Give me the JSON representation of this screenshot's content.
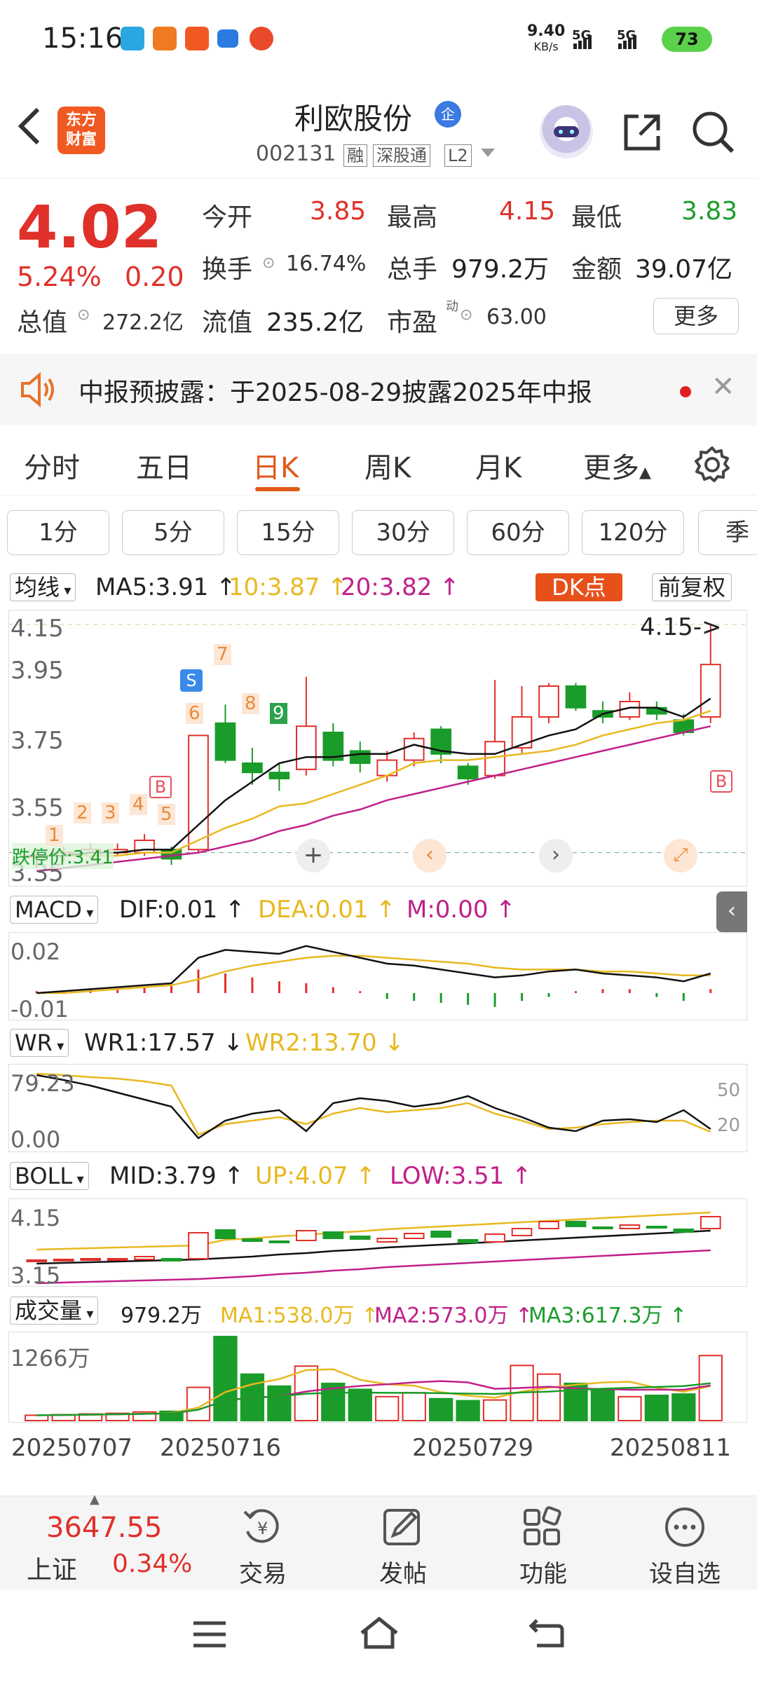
{
  "status_bar": {
    "time": "15:16",
    "net_speed": "9.40",
    "net_unit": "KB/s",
    "sim1": "5G",
    "sim2": "5G",
    "battery": "73"
  },
  "header": {
    "app_logo_line1": "东方",
    "app_logo_line2": "财富",
    "stock_name": "利欧股份",
    "badge": "企",
    "stock_code": "002131",
    "tags": [
      "融",
      "深股通",
      "L2"
    ]
  },
  "quote": {
    "price": "4.02",
    "change_pct": "5.24%",
    "change_abs": "0.20",
    "open_label": "今开",
    "open": "3.85",
    "high_label": "最高",
    "high": "4.15",
    "low_label": "最低",
    "low": "3.83",
    "turnover_label": "换手",
    "turnover": "16.74%",
    "volume_label": "总手",
    "volume": "979.2万",
    "amount_label": "金额",
    "amount": "39.07亿",
    "mktcap_label": "总值",
    "mktcap": "272.2亿",
    "float_label": "流值",
    "float": "235.2亿",
    "pe_label": "市盈",
    "pe_sup": "动",
    "pe": "63.00",
    "more": "更多"
  },
  "notice": {
    "text": "中报预披露：于2025-08-29披露2025年中报"
  },
  "period_tabs": [
    "分时",
    "五日",
    "日K",
    "周K",
    "月K",
    "更多"
  ],
  "minute_buttons": [
    "1分",
    "5分",
    "15分",
    "30分",
    "60分",
    "120分",
    "季"
  ],
  "ma_row": {
    "selector": "均线",
    "ma5": "MA5:3.91",
    "ma10": "10:3.87",
    "ma20": "20:3.82",
    "dk": "DK点",
    "adjust": "前复权"
  },
  "kline": {
    "y_labels": [
      "4.15",
      "3.95",
      "3.75",
      "3.55",
      "3.35"
    ],
    "high_marker": "4.15->",
    "limit_down_label": "跌停价:3.41",
    "b_label": "B",
    "s_label": "S",
    "seq_labels": [
      "1",
      "2",
      "3",
      "4",
      "5",
      "6",
      "7",
      "8",
      "9"
    ],
    "ma5_color": "#111111",
    "ma10_color": "#e8b820",
    "ma20_color": "#c0208a",
    "up_color": "#e0302a",
    "down_color": "#1a9c2a"
  },
  "macd_row": {
    "selector": "MACD",
    "dif": "DIF:0.01",
    "dea": "DEA:0.01",
    "m": "M:0.00",
    "y_labels": [
      "0.02",
      "-0.01"
    ]
  },
  "wr_row": {
    "selector": "WR",
    "wr1": "WR1:17.57",
    "wr2": "WR2:13.70",
    "y_labels": [
      "79.23",
      "0.00"
    ],
    "right_labels": [
      "50",
      "20"
    ]
  },
  "boll_row": {
    "selector": "BOLL",
    "mid": "MID:3.79",
    "up": "UP:4.07",
    "low": "LOW:3.51",
    "y_labels": [
      "4.15",
      "3.15"
    ]
  },
  "vol_row": {
    "selector": "成交量",
    "vol": "979.2万",
    "ma1": "MA1:538.0万",
    "ma2": "MA2:573.0万",
    "ma3": "MA3:617.3万",
    "y_label": "1266万"
  },
  "dates": [
    "20250707",
    "20250716",
    "20250729",
    "20250811"
  ],
  "bottom_nav": {
    "index_value": "3647.55",
    "index_name": "上证",
    "index_change": "0.34%",
    "trade": "交易",
    "post": "发帖",
    "function": "功能",
    "watchlist": "设自选"
  },
  "chart_data": {
    "type": "candlestick",
    "title": "",
    "y_range": [
      3.35,
      4.15
    ],
    "candles": [
      {
        "o": 3.4,
        "c": 3.4,
        "h": 3.42,
        "l": 3.36
      },
      {
        "o": 3.4,
        "c": 3.41,
        "h": 3.43,
        "l": 3.38
      },
      {
        "o": 3.4,
        "c": 3.42,
        "h": 3.44,
        "l": 3.39
      },
      {
        "o": 3.41,
        "c": 3.42,
        "h": 3.44,
        "l": 3.4
      },
      {
        "o": 3.41,
        "c": 3.45,
        "h": 3.47,
        "l": 3.4
      },
      {
        "o": 3.42,
        "c": 3.39,
        "h": 3.43,
        "l": 3.37
      },
      {
        "o": 3.42,
        "c": 3.79,
        "h": 3.79,
        "l": 3.41
      },
      {
        "o": 3.83,
        "c": 3.71,
        "h": 3.89,
        "l": 3.7
      },
      {
        "o": 3.7,
        "c": 3.67,
        "h": 3.75,
        "l": 3.63
      },
      {
        "o": 3.67,
        "c": 3.65,
        "h": 3.7,
        "l": 3.61
      },
      {
        "o": 3.68,
        "c": 3.82,
        "h": 3.98,
        "l": 3.66
      },
      {
        "o": 3.8,
        "c": 3.71,
        "h": 3.83,
        "l": 3.69
      },
      {
        "o": 3.74,
        "c": 3.7,
        "h": 3.77,
        "l": 3.67
      },
      {
        "o": 3.66,
        "c": 3.71,
        "h": 3.74,
        "l": 3.64
      },
      {
        "o": 3.71,
        "c": 3.78,
        "h": 3.8,
        "l": 3.69
      },
      {
        "o": 3.81,
        "c": 3.73,
        "h": 3.82,
        "l": 3.7
      },
      {
        "o": 3.69,
        "c": 3.65,
        "h": 3.7,
        "l": 3.63
      },
      {
        "o": 3.66,
        "c": 3.77,
        "h": 3.97,
        "l": 3.65
      },
      {
        "o": 3.75,
        "c": 3.85,
        "h": 3.95,
        "l": 3.73
      },
      {
        "o": 3.85,
        "c": 3.95,
        "h": 3.96,
        "l": 3.83
      },
      {
        "o": 3.95,
        "c": 3.88,
        "h": 3.96,
        "l": 3.87
      },
      {
        "o": 3.87,
        "c": 3.85,
        "h": 3.9,
        "l": 3.83
      },
      {
        "o": 3.85,
        "c": 3.9,
        "h": 3.93,
        "l": 3.84
      },
      {
        "o": 3.88,
        "c": 3.86,
        "h": 3.9,
        "l": 3.84
      },
      {
        "o": 3.84,
        "c": 3.8,
        "h": 3.86,
        "l": 3.79
      },
      {
        "o": 3.85,
        "c": 4.02,
        "h": 4.15,
        "l": 3.83
      }
    ],
    "ma5": [
      3.4,
      3.4,
      3.41,
      3.41,
      3.42,
      3.42,
      3.5,
      3.58,
      3.64,
      3.7,
      3.72,
      3.72,
      3.73,
      3.73,
      3.76,
      3.74,
      3.73,
      3.73,
      3.76,
      3.79,
      3.81,
      3.86,
      3.88,
      3.88,
      3.85,
      3.91
    ],
    "ma10": [
      3.4,
      3.4,
      3.4,
      3.4,
      3.41,
      3.41,
      3.45,
      3.49,
      3.52,
      3.56,
      3.57,
      3.6,
      3.63,
      3.66,
      3.7,
      3.71,
      3.71,
      3.72,
      3.73,
      3.74,
      3.76,
      3.79,
      3.81,
      3.83,
      3.84,
      3.87
    ],
    "ma20": [
      3.35,
      3.36,
      3.37,
      3.38,
      3.39,
      3.4,
      3.41,
      3.43,
      3.45,
      3.48,
      3.5,
      3.53,
      3.55,
      3.58,
      3.6,
      3.62,
      3.64,
      3.66,
      3.68,
      3.7,
      3.72,
      3.74,
      3.76,
      3.78,
      3.8,
      3.82
    ],
    "volume_wan": [
      80,
      90,
      100,
      110,
      130,
      140,
      500,
      1266,
      700,
      520,
      820,
      560,
      470,
      360,
      420,
      330,
      300,
      310,
      830,
      700,
      560,
      470,
      360,
      380,
      400,
      979
    ],
    "macd_hist": [
      0.001,
      0.001,
      0.002,
      0.002,
      0.003,
      0.004,
      0.012,
      0.01,
      0.008,
      0.006,
      0.005,
      0.003,
      0.001,
      -0.003,
      -0.004,
      -0.005,
      -0.006,
      -0.007,
      -0.004,
      -0.002,
      0.001,
      0.002,
      0.002,
      -0.002,
      -0.004,
      0.002
    ]
  }
}
